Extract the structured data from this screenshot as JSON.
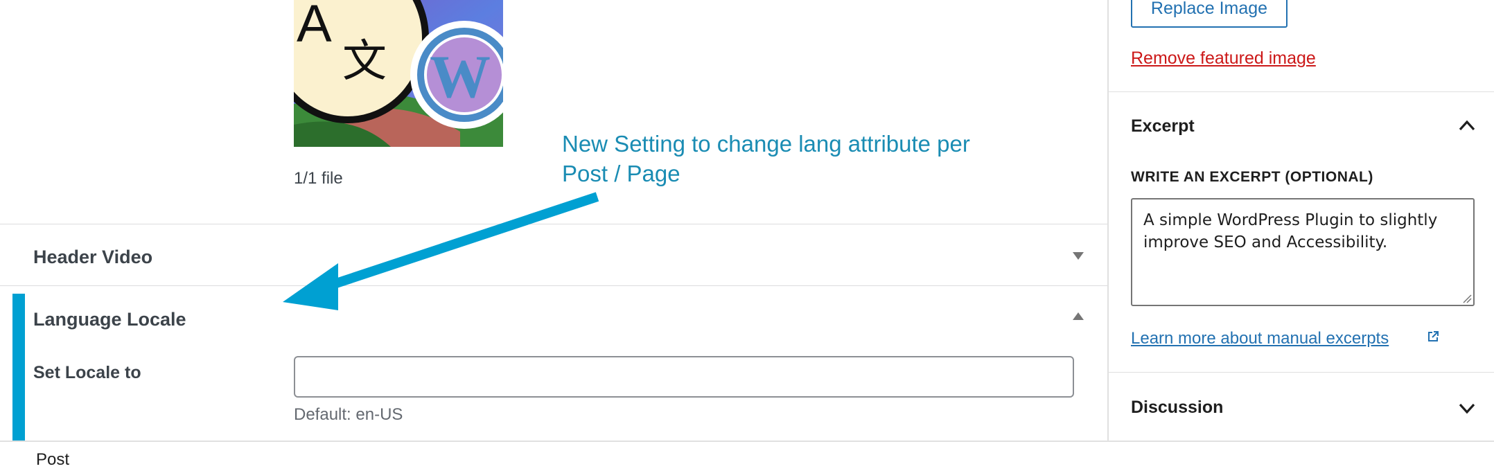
{
  "main": {
    "featured_media": {
      "file_count": "1/1 file",
      "glyph_latin": "A",
      "glyph_cjk": "文"
    },
    "panels": {
      "header_video": {
        "title": "Header Video",
        "state": "collapsed",
        "toggle_icon": "triangle-down-icon"
      },
      "language_locale": {
        "title": "Language Locale",
        "state": "expanded",
        "toggle_icon": "triangle-up-icon",
        "field_label": "Set Locale to",
        "field_value": "",
        "field_hint": "Default: en-US"
      }
    }
  },
  "annotation": {
    "text": "New Setting to change lang attribute per Post / Page",
    "color": "#1a8cb3",
    "arrow_color": "#00a0d2"
  },
  "sidebar": {
    "featured_image": {
      "replace_label": "Replace Image",
      "remove_label": "Remove featured image"
    },
    "excerpt": {
      "title": "Excerpt",
      "state": "expanded",
      "label": "WRITE AN EXCERPT (OPTIONAL)",
      "value": "A simple WordPress Plugin to slightly improve SEO and Accessibility.",
      "learn_more": "Learn more about manual excerpts"
    },
    "discussion": {
      "title": "Discussion",
      "state": "collapsed"
    }
  },
  "footer": {
    "breadcrumb": "Post"
  },
  "colors": {
    "accent": "#00a0d2",
    "link": "#2271b1",
    "destructive": "#cc1818"
  }
}
